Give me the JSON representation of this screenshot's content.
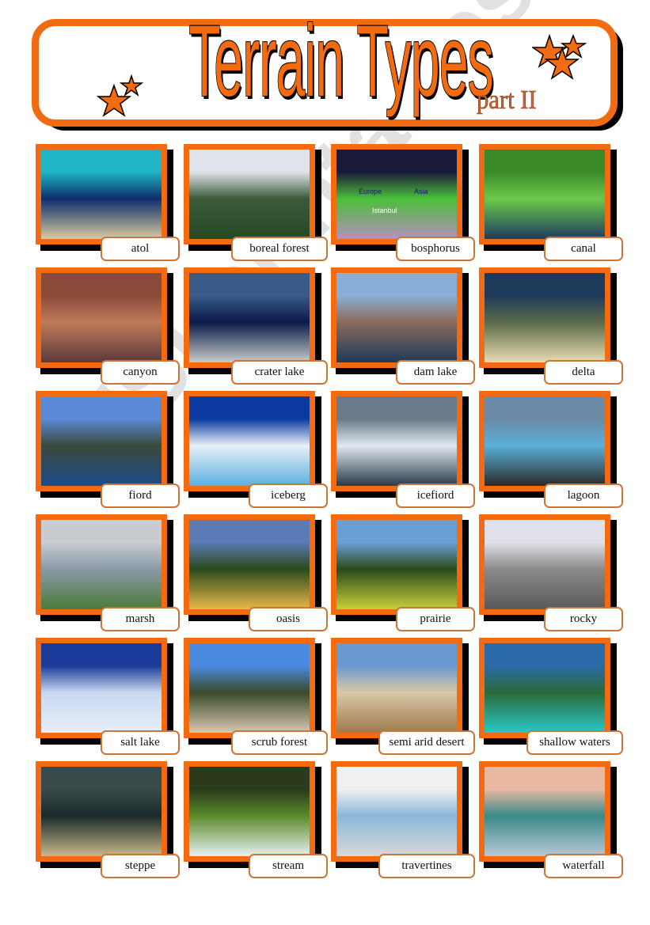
{
  "header": {
    "title": "Terrain Types",
    "subtitle": "part II",
    "accent_color": "#f26b10"
  },
  "watermark": "ESLprintables.com",
  "cards": [
    {
      "label": "atol",
      "icon": "atoll-photo",
      "colors": [
        "#1fb5c4",
        "#0c2d6a",
        "#d9caa0"
      ]
    },
    {
      "label": "boreal forest",
      "icon": "boreal-forest-photo",
      "colors": [
        "#dfe4ea",
        "#3b5a3a",
        "#254a22"
      ]
    },
    {
      "label": "bosphorus",
      "icon": "bosphorus-satellite-photo",
      "colors": [
        "#1a1a3a",
        "#4bbf3a",
        "#b58fbf"
      ],
      "map_labels": [
        "Europe",
        "Asia",
        "Istanbul"
      ]
    },
    {
      "label": "canal",
      "icon": "canal-photo",
      "colors": [
        "#3a8a2a",
        "#6cc94a",
        "#1e3b5e"
      ]
    },
    {
      "label": "canyon",
      "icon": "canyon-photo",
      "colors": [
        "#8a4a3a",
        "#c07a5a",
        "#5a3a3a"
      ]
    },
    {
      "label": "crater lake",
      "icon": "crater-lake-photo",
      "colors": [
        "#3a5a8a",
        "#0a1a4a",
        "#c8ccc8"
      ]
    },
    {
      "label": "dam lake",
      "icon": "dam-lake-photo",
      "colors": [
        "#8ab0d8",
        "#8a6a5a",
        "#1e3a5a"
      ]
    },
    {
      "label": "delta",
      "icon": "delta-photo",
      "colors": [
        "#1e3a5a",
        "#5a6a4a",
        "#e8dcb0"
      ]
    },
    {
      "label": "fiord",
      "icon": "fiord-photo",
      "colors": [
        "#5a8ad8",
        "#3a4a3a",
        "#1e4a8a"
      ]
    },
    {
      "label": "iceberg",
      "icon": "iceberg-photo",
      "colors": [
        "#0a3aa0",
        "#e8f0f8",
        "#5ab0e0"
      ]
    },
    {
      "label": "icefiord",
      "icon": "icefiord-photo",
      "colors": [
        "#6a7a8a",
        "#e0e8f0",
        "#2a3a4a"
      ]
    },
    {
      "label": "lagoon",
      "icon": "lagoon-photo",
      "colors": [
        "#6a8aa8",
        "#5ab0d8",
        "#2a2a2a"
      ]
    },
    {
      "label": "marsh",
      "icon": "marsh-photo",
      "colors": [
        "#c8ccd0",
        "#8a9aa8",
        "#4a7a3a"
      ]
    },
    {
      "label": "oasis",
      "icon": "oasis-photo",
      "colors": [
        "#5a7ab8",
        "#2a4a1a",
        "#e8b84a"
      ]
    },
    {
      "label": "prairie",
      "icon": "prairie-photo",
      "colors": [
        "#6aa0d8",
        "#2a4a1a",
        "#c8d03a"
      ]
    },
    {
      "label": "rocky",
      "icon": "rocky-photo",
      "colors": [
        "#e0e0ea",
        "#8a8a8a",
        "#5a5a5a"
      ]
    },
    {
      "label": "salt lake",
      "icon": "salt-lake-photo",
      "colors": [
        "#1a3a9a",
        "#c8d8f0",
        "#e8eef8"
      ]
    },
    {
      "label": "scrub forest",
      "icon": "scrub-forest-photo",
      "colors": [
        "#4a8ae0",
        "#3a4a2a",
        "#d8c8b0"
      ]
    },
    {
      "label": "semi arid desert",
      "icon": "semi-arid-desert-photo",
      "colors": [
        "#6a9ad0",
        "#d8c8a8",
        "#a07a4a"
      ]
    },
    {
      "label": "shallow waters",
      "icon": "shallow-waters-photo",
      "colors": [
        "#2a6aa8",
        "#2a6a3a",
        "#2ac8c8"
      ]
    },
    {
      "label": "steppe",
      "icon": "steppe-photo",
      "colors": [
        "#3a4a4a",
        "#1a2a2a",
        "#c8b88a"
      ]
    },
    {
      "label": "stream",
      "icon": "stream-photo",
      "colors": [
        "#2a3a1a",
        "#5a8a2a",
        "#e8f0f0"
      ]
    },
    {
      "label": "travertines",
      "icon": "travertines-photo",
      "colors": [
        "#f0f0f0",
        "#8ab8d8",
        "#d8d8d8"
      ]
    },
    {
      "label": "waterfall",
      "icon": "waterfall-photo",
      "colors": [
        "#e8b8a0",
        "#3a8a8a",
        "#b8c8d8"
      ]
    }
  ]
}
